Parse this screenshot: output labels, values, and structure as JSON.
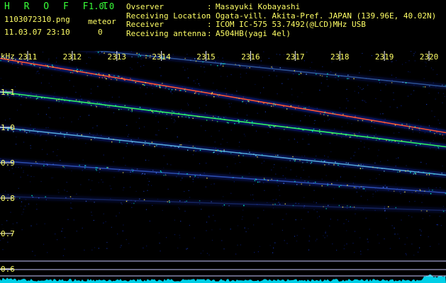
{
  "app": {
    "title": "H R O F F T",
    "version": "1.0.0"
  },
  "file_name": "1103072310.png",
  "datetime": "11.03.07 23:10",
  "meteor": {
    "label": "meteor",
    "count": "0"
  },
  "info": [
    {
      "key": "Ovserver",
      "value": "Masayuki Kobayashi"
    },
    {
      "key": "Receiving Location",
      "value": "Ogata-vill. Akita-Pref. JAPAN (139.96E, 40.02N)"
    },
    {
      "key": "Receiver",
      "value": "ICOM IC-575 53.7492(@LCD)MHz USB"
    },
    {
      "key": "Receiving antenna",
      "value": "A504HB(yagi 4el)"
    }
  ],
  "colors": {
    "label": "#ffff66",
    "title": "#39ff39",
    "signal": "#00e5ff",
    "background": "#000000"
  },
  "spectrogram": {
    "y_unit": "kHz",
    "y_ticks": [
      "1.1",
      "1.0",
      "0.9",
      "0.8",
      "0.7",
      "0.6"
    ],
    "y_tick_values": [
      1.1,
      1.0,
      0.9,
      0.8,
      0.7,
      0.6
    ],
    "x_ticks": [
      "2311",
      "2312",
      "2313",
      "2314",
      "2315",
      "2316",
      "2317",
      "2318",
      "2319",
      "2320"
    ],
    "traces": [
      {
        "start_khz": 1.195,
        "end_khz": 0.985,
        "color": "#ff5533",
        "intensity": 1.0
      },
      {
        "start_khz": 1.1,
        "end_khz": 0.945,
        "color": "#33ff66",
        "intensity": 0.95
      },
      {
        "start_khz": 1.0,
        "end_khz": 0.865,
        "color": "#66ccff",
        "intensity": 0.8
      },
      {
        "start_khz": 0.905,
        "end_khz": 0.815,
        "color": "#4477ff",
        "intensity": 0.6
      },
      {
        "start_khz": 0.805,
        "end_khz": 0.765,
        "color": "#3355cc",
        "intensity": 0.35
      },
      {
        "start_khz": 1.245,
        "end_khz": 1.115,
        "color": "#5599ff",
        "intensity": 0.5
      }
    ]
  }
}
